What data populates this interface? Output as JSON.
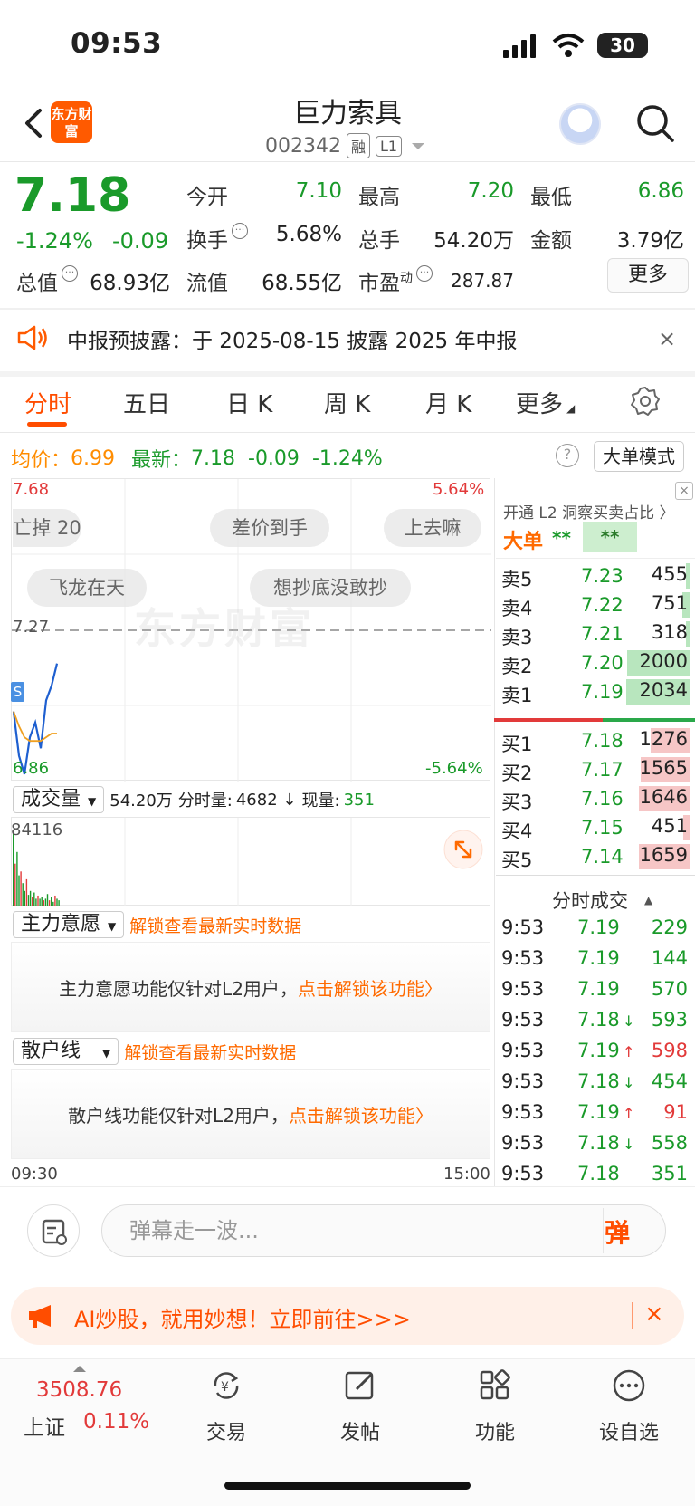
{
  "status": {
    "time": "09:53",
    "battery": "30"
  },
  "nav": {
    "logo": "东方财富",
    "title": "巨力索具",
    "code": "002342",
    "badge1": "融",
    "badge2": "L1"
  },
  "quote": {
    "price": "7.18",
    "chg_pct": "-1.24%",
    "chg_val": "-0.09",
    "open_label": "今开",
    "open": "7.10",
    "high_label": "最高",
    "high": "7.20",
    "low_label": "最低",
    "low": "6.86",
    "turnover_label": "换手",
    "turnover": "5.68%",
    "vol_label": "总手",
    "vol": "54.20万",
    "amount_label": "金额",
    "amount": "3.79亿",
    "mktcap_label": "总值",
    "mktcap": "68.93亿",
    "float_label": "流值",
    "float": "68.55亿",
    "pe_label": "市盈",
    "pe_sup": "动",
    "pe": "287.87",
    "more": "更多"
  },
  "notice": {
    "text": "中报预披露：于 2025-08-15 披露 2025 年中报",
    "close": "×"
  },
  "tabs": [
    "分时",
    "五日",
    "日 K",
    "周 K",
    "月 K",
    "更多"
  ],
  "chart_info": {
    "avg_label": "均价：",
    "avg": "6.99",
    "last_label": "最新：",
    "last": "7.18",
    "chg": "-0.09",
    "pct": "-1.24%",
    "help": "?",
    "mode": "大单模式"
  },
  "chart": {
    "y_top": "7.68",
    "y_mid": "7.27",
    "y_bot": "6.86",
    "pct_top": "5.64%",
    "pct_bot": "-5.64%",
    "danmu": [
      "亡掉 20",
      "差价到手",
      "上去嘛",
      "飞龙在天",
      "想抄底没敢抄"
    ],
    "watermark": "东方财富",
    "s_marker": "S",
    "time_start": "09:30",
    "time_end": "15:00"
  },
  "chart_data": {
    "type": "line",
    "title": "",
    "ylim": [
      6.86,
      7.68
    ],
    "series": [
      {
        "name": "",
        "values": [
          7.05,
          6.93,
          6.88,
          6.98,
          7.02,
          6.95,
          7.08,
          7.12,
          7.18
        ]
      },
      {
        "name": "均价",
        "values": [
          7.05,
          7.01,
          6.98,
          6.97,
          6.97,
          6.97,
          6.98,
          6.99,
          6.99
        ]
      }
    ],
    "volume_max": "84116"
  },
  "volume": {
    "label": "成交量",
    "total": "54.20万",
    "detail_label": "分时量:",
    "detail": "4682 ↓",
    "now_label": "现量:",
    "now": "351",
    "max": "84116"
  },
  "zhuli": {
    "label": "主力意愿",
    "link": "解锁查看最新实时数据",
    "box_text": "主力意愿功能仅针对L2用户，",
    "box_link": "点击解锁该功能〉"
  },
  "sanhu": {
    "label": "散户线",
    "link": "解锁查看最新实时数据",
    "box_text": "散户线功能仅针对L2用户，",
    "box_link": "点击解锁该功能〉"
  },
  "orderbook": {
    "head": "开通 L2 洞察买卖占比 〉",
    "bigdan": "大单",
    "star1": "**",
    "star2": "**",
    "asks": [
      {
        "label": "卖5",
        "price": "7.23",
        "vol": "455",
        "frac": 0.05
      },
      {
        "label": "卖4",
        "price": "7.22",
        "vol": "751",
        "frac": 0.12
      },
      {
        "label": "卖3",
        "price": "7.21",
        "vol": "318",
        "frac": 0.05
      },
      {
        "label": "卖2",
        "price": "7.20",
        "vol": "2000",
        "frac": 0.98
      },
      {
        "label": "卖1",
        "price": "7.19",
        "vol": "2034",
        "frac": 1.0
      }
    ],
    "bids": [
      {
        "label": "买1",
        "price": "7.18",
        "vol": "1276",
        "frac": 0.62
      },
      {
        "label": "买2",
        "price": "7.17",
        "vol": "1565",
        "frac": 0.77
      },
      {
        "label": "买3",
        "price": "7.16",
        "vol": "1646",
        "frac": 0.8
      },
      {
        "label": "买4",
        "price": "7.15",
        "vol": "451",
        "frac": 0.1
      },
      {
        "label": "买5",
        "price": "7.14",
        "vol": "1659",
        "frac": 0.8
      }
    ]
  },
  "ticks": {
    "head": "分时成交",
    "rows": [
      {
        "time": "9:53",
        "price": "7.19",
        "dir": "",
        "vol": "229",
        "color": "green"
      },
      {
        "time": "9:53",
        "price": "7.19",
        "dir": "",
        "vol": "144",
        "color": "green"
      },
      {
        "time": "9:53",
        "price": "7.19",
        "dir": "",
        "vol": "570",
        "color": "green"
      },
      {
        "time": "9:53",
        "price": "7.18",
        "dir": "↓",
        "vol": "593",
        "color": "green"
      },
      {
        "time": "9:53",
        "price": "7.19",
        "dir": "↑",
        "vol": "598",
        "color": "red"
      },
      {
        "time": "9:53",
        "price": "7.18",
        "dir": "↓",
        "vol": "454",
        "color": "green"
      },
      {
        "time": "9:53",
        "price": "7.19",
        "dir": "↑",
        "vol": "91",
        "color": "red"
      },
      {
        "time": "9:53",
        "price": "7.18",
        "dir": "↓",
        "vol": "558",
        "color": "green"
      },
      {
        "time": "9:53",
        "price": "7.18",
        "dir": "",
        "vol": "351",
        "color": "green"
      }
    ]
  },
  "comment": {
    "placeholder": "弹幕走一波...",
    "dan": "弹"
  },
  "promo": {
    "text": "AI炒股，就用妙想！立即前往>>>",
    "close": "×"
  },
  "tabbar": {
    "index_val": "3508.76",
    "index_name": "上证",
    "index_chg": "0.11%",
    "items": [
      "交易",
      "发帖",
      "功能",
      "设自选"
    ]
  }
}
